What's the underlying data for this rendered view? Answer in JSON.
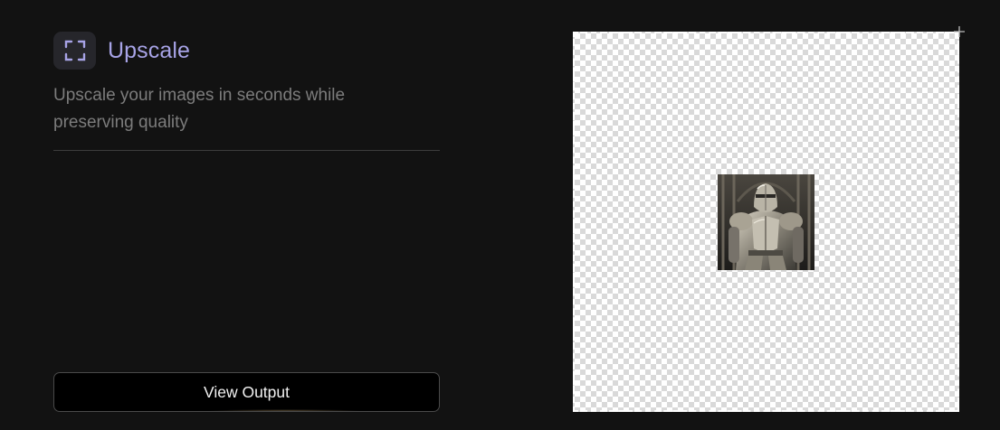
{
  "tool": {
    "title": "Upscale",
    "subtitle": "Upscale your images in seconds while preserving quality",
    "icon": "expand-corners-icon"
  },
  "actions": {
    "view_output_label": "View Output"
  },
  "canvas": {
    "image_subject": "knight-in-armor",
    "handle_icon": "plus-icon"
  },
  "colors": {
    "background": "#121212",
    "accent": "#a7a3e6",
    "subtitle": "#7c7c7c",
    "button_bg": "#000000"
  }
}
